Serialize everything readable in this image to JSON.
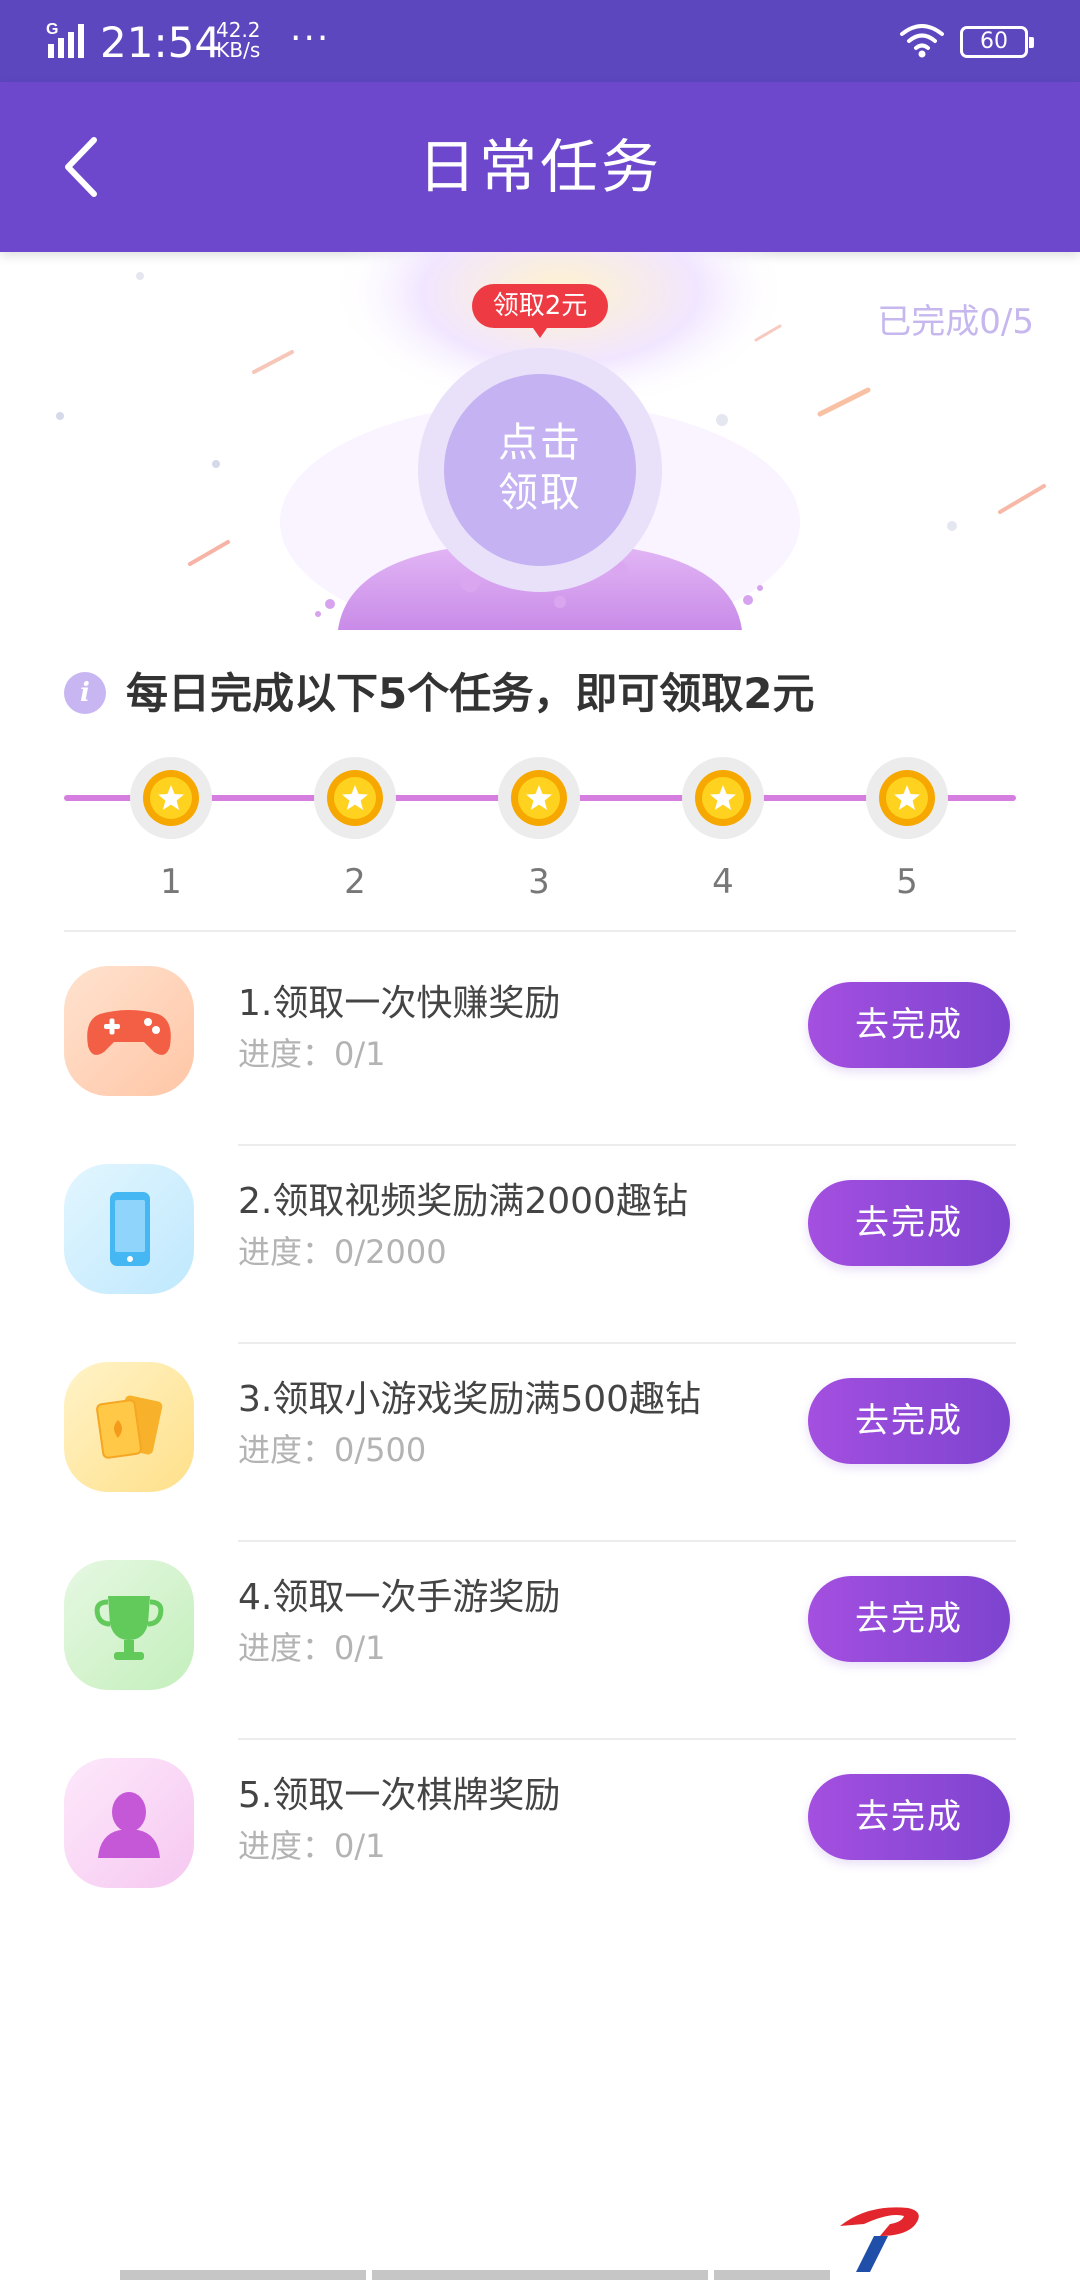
{
  "status_bar": {
    "network": "G",
    "time": "21:54",
    "speed_value": "42.2",
    "speed_unit": "KB/s",
    "more": "···",
    "battery": "60"
  },
  "header": {
    "title": "日常任务",
    "back_icon": "chevron-left-icon"
  },
  "hero": {
    "badge": "领取2元",
    "claim_line1": "点击",
    "claim_line2": "领取",
    "completed": "已完成0/5"
  },
  "info": {
    "icon": "info-icon",
    "text": "每日完成以下5个任务，即可领取2元"
  },
  "steps": [
    "1",
    "2",
    "3",
    "4",
    "5"
  ],
  "tasks": [
    {
      "title": "1.领取一次快赚奖励",
      "progress": "进度：0/1",
      "button": "去完成",
      "icon": "gamepad-icon"
    },
    {
      "title": "2.领取视频奖励满2000趣钻",
      "progress": "进度：0/2000",
      "button": "去完成",
      "icon": "phone-icon"
    },
    {
      "title": "3.领取小游戏奖励满500趣钻",
      "progress": "进度：0/500",
      "button": "去完成",
      "icon": "cards-icon"
    },
    {
      "title": "4.领取一次手游奖励",
      "progress": "进度：0/1",
      "button": "去完成",
      "icon": "trophy-icon"
    },
    {
      "title": "5.领取一次棋牌奖励",
      "progress": "进度：0/1",
      "button": "去完成",
      "icon": "person-icon"
    }
  ],
  "colors": {
    "header": "#6e48cc",
    "button_start": "#a44fe0",
    "button_end": "#7d44cf",
    "progress_line": "#d57ee0",
    "badge": "#ee3b43"
  }
}
